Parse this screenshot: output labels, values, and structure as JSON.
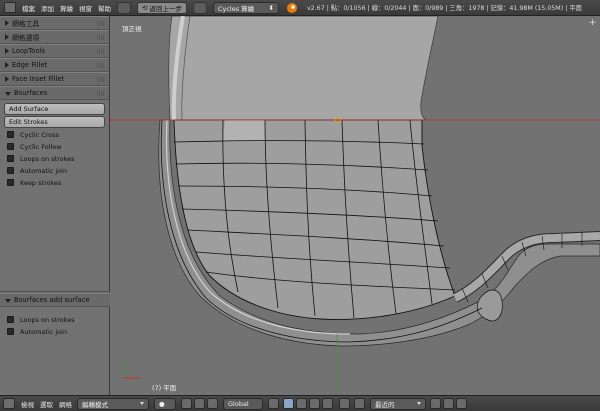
{
  "topbar": {
    "menus": [
      "檔案",
      "添加",
      "算繪",
      "視窗",
      "幫助"
    ],
    "undo_label": "返回上一步",
    "engine": "Cycles 算繪",
    "stats": "v2.67 | 點：0/1056 | 線：0/2044 | 面：0/989 | 三角：1978 | 記憶：41.98M (15.05M) | 平面"
  },
  "toolshelf": {
    "panels": [
      "網格工具",
      "網格選項",
      "LoopTools",
      "Edge Fillet",
      "Face Inset Fillet"
    ],
    "bsurfaces": {
      "title": "Bsurfaces",
      "add_surface": "Add Surface",
      "edit_strokes": "Edit Strokes",
      "options": [
        "Cyclic Cross",
        "Cyclic Follow",
        "Loops on strokes",
        "Automatic join",
        "Keep strokes"
      ]
    },
    "operator": {
      "title": "Bsurfaces add surface",
      "options": [
        "Loops on strokes",
        "Automatic join"
      ]
    }
  },
  "viewport": {
    "view_label": "頂正視",
    "object_label": "(7) 平面"
  },
  "botbar": {
    "menus": [
      "檢視",
      "選取",
      "網格"
    ],
    "mode": "編輯模式",
    "orientation": "Global",
    "snap": "最近的"
  },
  "colors": {
    "mesh_face": "#9e9e9e",
    "wire": "#111111",
    "bg": "#727272",
    "axis_red": "#c03030",
    "axis_green": "#3a9a3a"
  }
}
